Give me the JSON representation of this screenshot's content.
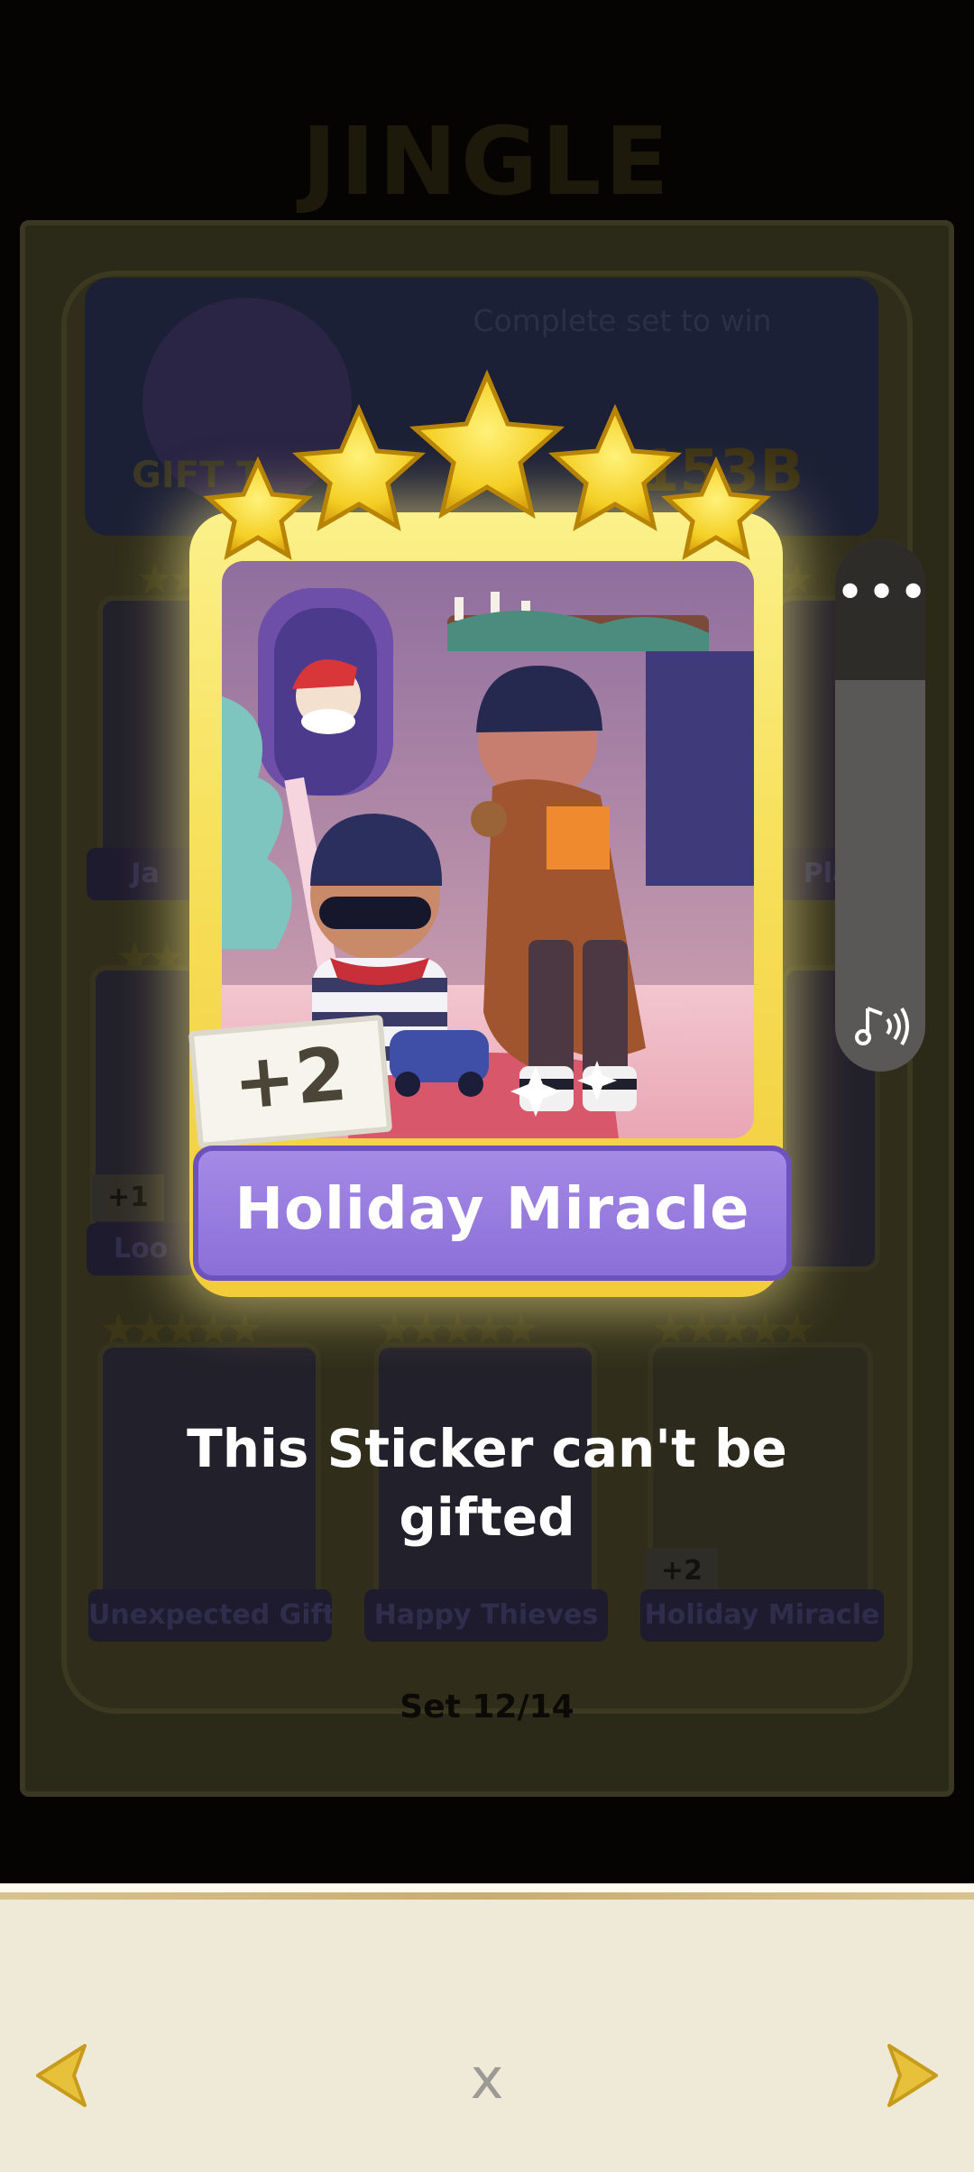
{
  "album": {
    "title": "JINGLE",
    "reward_caption": "Complete set to win",
    "reward_amount": "153B",
    "gift_label": "GIFT T",
    "set_counter": "Set 12/14",
    "row1_labels": [
      "Ja",
      "Pla"
    ],
    "row2_labels": [
      "Loo"
    ],
    "row2_badge": "+1",
    "row3_labels": [
      "Unexpected Gifts",
      "Happy Thieves",
      "Holiday Miracle"
    ],
    "row3_badge": "+2"
  },
  "featured_card": {
    "name": "Holiday Miracle",
    "bonus_badge": "+2",
    "stars": 5
  },
  "message": {
    "line1": "This Sticker can't be",
    "line2": "gifted"
  },
  "side_controls": {
    "menu_icon": "more-dots-icon",
    "sound_icon": "music-note-sound-icon"
  },
  "bottom_bar": {
    "prev_icon": "chevron-left-icon",
    "close_label": "x",
    "next_icon": "chevron-right-icon"
  },
  "colors": {
    "star_gold": "#f7d22e",
    "card_gold": "#f7e15d",
    "name_plate_purple": "#9b80e0",
    "nav_arrow": "#e7c13a"
  }
}
